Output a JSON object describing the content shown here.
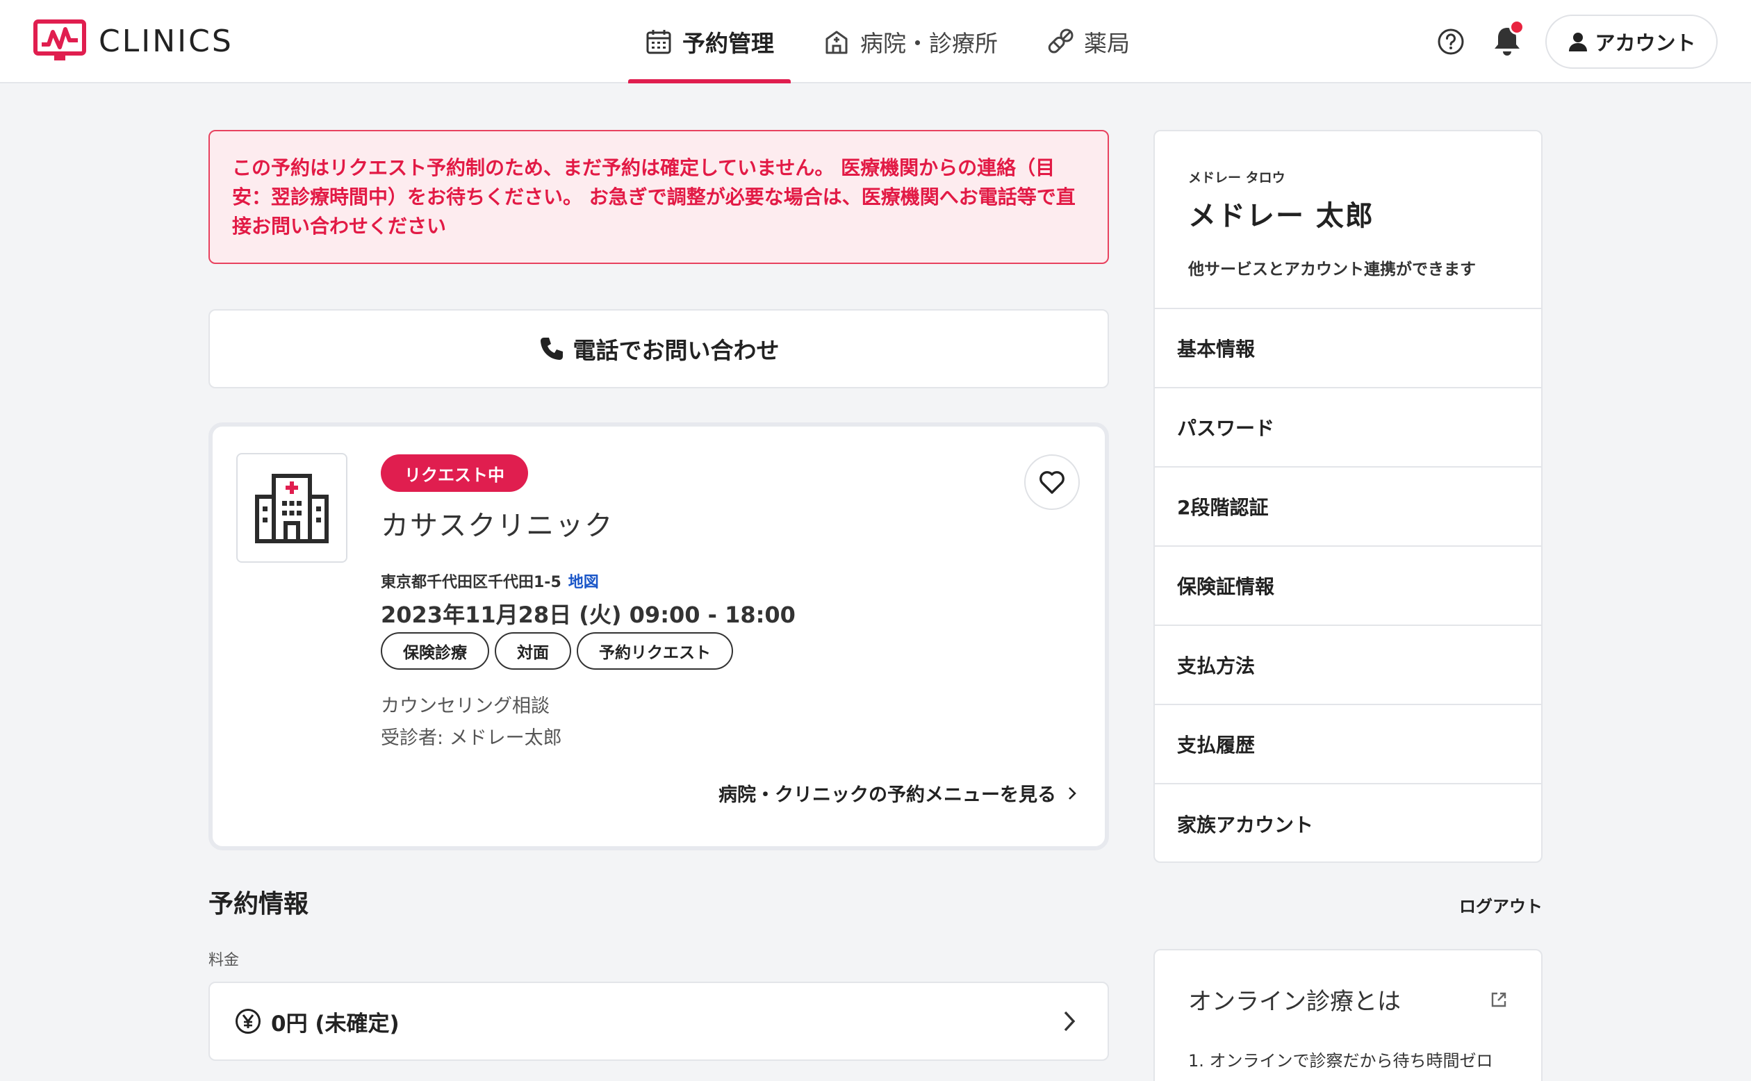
{
  "header": {
    "logo_text": "CLINICS",
    "nav": [
      {
        "label": "予約管理",
        "icon": "calendar-icon",
        "active": true
      },
      {
        "label": "病院・診療所",
        "icon": "hospital-icon",
        "active": false
      },
      {
        "label": "薬局",
        "icon": "pill-icon",
        "active": false
      }
    ],
    "account_label": "アカウント"
  },
  "alert": {
    "text": "この予約はリクエスト予約制のため、まだ予約は確定していません。 医療機関からの連絡（目安：翌診療時間中）をお待ちください。 お急ぎで調整が必要な場合は、医療機関へお電話等で直接お問い合わせください"
  },
  "phone_button": {
    "label": "電話でお問い合わせ"
  },
  "clinic": {
    "status": "リクエスト中",
    "name": "カサスクリニック",
    "address": "東京都千代田区千代田1-5",
    "map_label": "地図",
    "datetime": "2023年11月28日 (火) 09:00 - 18:00",
    "tags": [
      "保険診療",
      "対面",
      "予約リクエスト"
    ],
    "menu": "カウンセリング相談",
    "patient": "受診者: メドレー太郎",
    "menu_link": "病院・クリニックの予約メニューを見る"
  },
  "reservation": {
    "section_title": "予約情報",
    "fee_label": "料金",
    "fee_value": "0円 (未確定)"
  },
  "account": {
    "kana": "メドレー タロウ",
    "name": "メドレー 太郎",
    "link_text": "他サービスとアカウント連携ができます",
    "menu": [
      "基本情報",
      "パスワード",
      "2段階認証",
      "保険証情報",
      "支払方法",
      "支払履歴",
      "家族アカウント"
    ],
    "logout": "ログアウト"
  },
  "online": {
    "title": "オンライン診療とは",
    "item1": "1. オンラインで診察だから待ち時間ゼロ"
  },
  "colors": {
    "accent": "#e01e4f",
    "alert_bg": "#fdecef",
    "link": "#1a56c8",
    "page_bg": "#f3f4f6"
  }
}
